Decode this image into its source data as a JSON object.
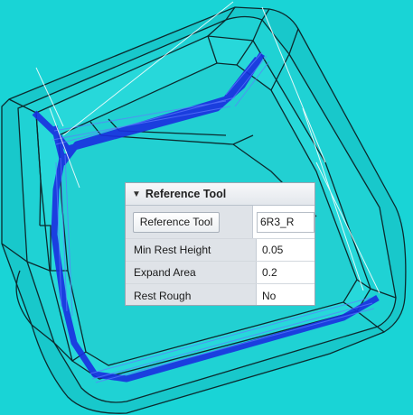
{
  "panel": {
    "title": "Reference Tool",
    "reference_tool_button": "Reference Tool",
    "reference_tool_value": "6R3_R",
    "rows": [
      {
        "label": "Min Rest Height",
        "value": "0.05"
      },
      {
        "label": "Expand Area",
        "value": "0.2"
      },
      {
        "label": "Rest Rough",
        "value": "No"
      }
    ]
  },
  "colors": {
    "background": "#19d4d6",
    "part_surface": "#21c6c9",
    "toolpath": "#1a2fe0"
  }
}
